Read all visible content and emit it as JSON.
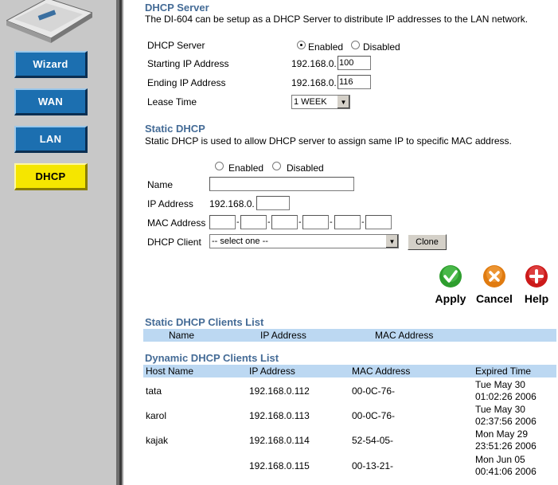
{
  "sidebar": {
    "nav": [
      {
        "label": "Wizard"
      },
      {
        "label": "WAN"
      },
      {
        "label": "LAN"
      },
      {
        "label": "DHCP"
      }
    ]
  },
  "dhcp_server": {
    "title": "DHCP Server",
    "description": "The DI-604 can be setup as a DHCP Server to distribute IP addresses to the LAN network.",
    "server_label": "DHCP Server",
    "enabled_label": "Enabled",
    "disabled_label": "Disabled",
    "selected": "Enabled",
    "start_label": "Starting IP Address",
    "start_prefix": "192.168.0.",
    "start_value": "100",
    "end_label": "Ending IP Address",
    "end_prefix": "192.168.0.",
    "end_value": "116",
    "lease_label": "Lease Time",
    "lease_value": "1 WEEK"
  },
  "static_dhcp": {
    "title": "Static DHCP",
    "description": "Static DHCP is used to allow DHCP server to assign same IP to specific MAC address.",
    "enabled_label": "Enabled",
    "disabled_label": "Disabled",
    "name_label": "Name",
    "name_value": "",
    "ip_label": "IP Address",
    "ip_prefix": "192.168.0.",
    "ip_value": "",
    "mac_label": "MAC Address",
    "mac_sep": "-",
    "client_label": "DHCP Client",
    "client_value": "-- select one --",
    "clone_label": "Clone"
  },
  "actions": {
    "apply": "Apply",
    "cancel": "Cancel",
    "help": "Help"
  },
  "static_list": {
    "title": "Static DHCP Clients List",
    "headers": {
      "name": "Name",
      "ip": "IP Address",
      "mac": "MAC Address"
    }
  },
  "dynamic_list": {
    "title": "Dynamic DHCP Clients List",
    "headers": {
      "host": "Host Name",
      "ip": "IP Address",
      "mac": "MAC Address",
      "expired": "Expired Time"
    },
    "rows": [
      {
        "host": "tata",
        "ip": "192.168.0.112",
        "mac": "00-0C-76-",
        "exp1": "Tue May 30",
        "exp2": "01:02:26 2006"
      },
      {
        "host": "karol",
        "ip": "192.168.0.113",
        "mac": "00-0C-76-",
        "exp1": "Tue May 30",
        "exp2": "02:37:56 2006"
      },
      {
        "host": "kajak",
        "ip": "192.168.0.114",
        "mac": "52-54-05-",
        "exp1": "Mon May 29",
        "exp2": "23:51:26 2006"
      },
      {
        "host": "",
        "ip": "192.168.0.115",
        "mac": "00-13-21-",
        "exp1": "Mon Jun 05",
        "exp2": "00:41:06 2006"
      }
    ]
  },
  "colors": {
    "section_title": "#446b96",
    "table_header": "#bcd8f2",
    "nav_blue": "#1c6fb0",
    "nav_active": "#f5e600",
    "sidebar_bg": "#c8c8c8"
  }
}
